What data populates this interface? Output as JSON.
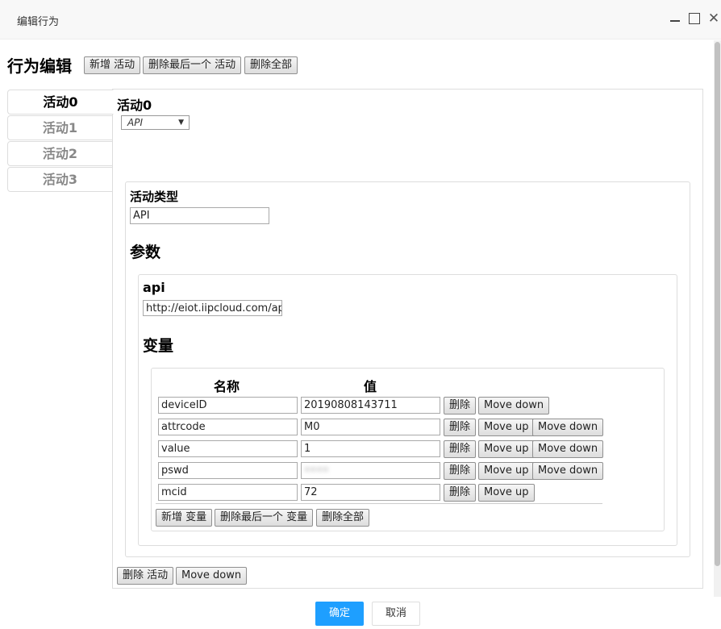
{
  "dialog": {
    "title": "编辑行为"
  },
  "window_controls": {
    "close_glyph": "✕"
  },
  "toolbar": {
    "heading": "行为编辑",
    "add_activity": "新增 活动",
    "remove_last_activity": "删除最后一个 活动",
    "remove_all": "删除全部"
  },
  "tabs": [
    {
      "label": "活动0",
      "active": true
    },
    {
      "label": "活动1",
      "active": false
    },
    {
      "label": "活动2",
      "active": false
    },
    {
      "label": "活动3",
      "active": false
    }
  ],
  "activity": {
    "heading": "活动0",
    "type_select": "API",
    "type_label": "活动类型",
    "type_value": "API",
    "params_heading": "参数",
    "api_label": "api",
    "api_value": "http://eiot.iipcloud.com/api/ct",
    "vars_heading": "变量",
    "col_name": "名称",
    "col_value": "值",
    "variables": [
      {
        "name": "deviceID",
        "value": "20190808143711",
        "delete": "删除",
        "move_up": "",
        "move_down": "Move down"
      },
      {
        "name": "attrcode",
        "value": "M0",
        "delete": "删除",
        "move_up": "Move up",
        "move_down": "Move down"
      },
      {
        "name": "value",
        "value": "1",
        "delete": "删除",
        "move_up": "Move up",
        "move_down": "Move down"
      },
      {
        "name": "pswd",
        "value": "••••",
        "delete": "删除",
        "move_up": "Move up",
        "move_down": "Move down"
      },
      {
        "name": "mcid",
        "value": "72",
        "delete": "删除",
        "move_up": "Move up",
        "move_down": ""
      }
    ],
    "add_var": "新增 变量",
    "remove_last_var": "删除最后一个 变量",
    "remove_all_vars": "删除全部",
    "delete_activity": "删除 活动",
    "move_down": "Move down"
  },
  "footer": {
    "confirm": "确定",
    "cancel": "取消"
  },
  "colors": {
    "primary": "#1e9fff",
    "border": "#dddddd"
  }
}
